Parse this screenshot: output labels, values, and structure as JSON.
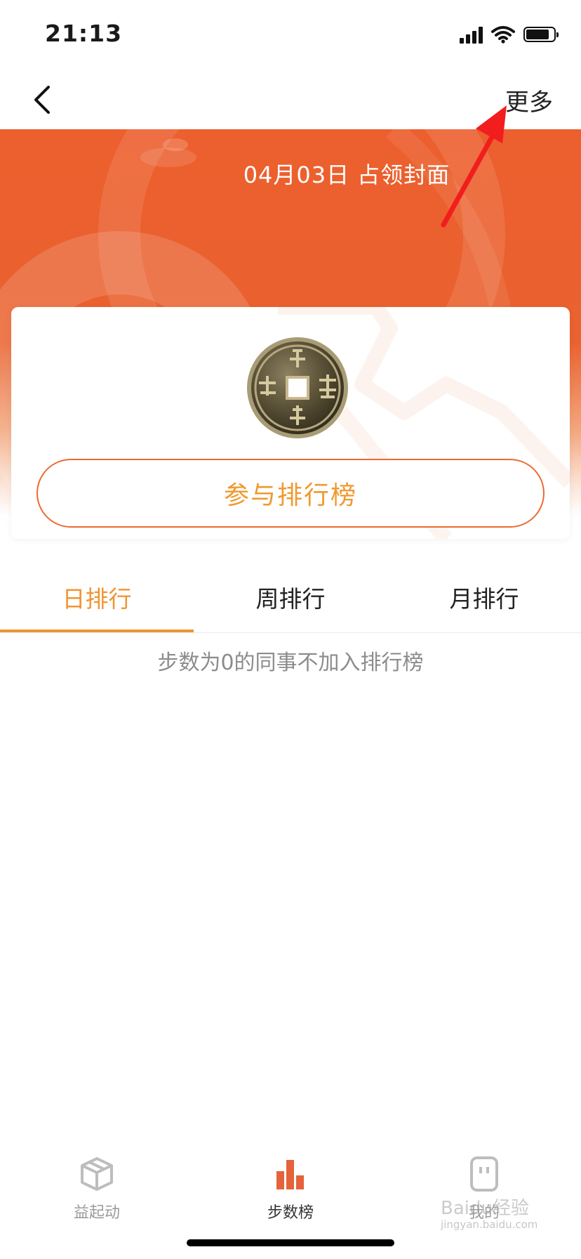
{
  "status_bar": {
    "time": "21:13"
  },
  "nav": {
    "more_label": "更多"
  },
  "hero": {
    "title": "04月03日 占领封面"
  },
  "card": {
    "join_label": "参与排行榜"
  },
  "tabs": [
    {
      "label": "日排行",
      "active": true
    },
    {
      "label": "周排行",
      "active": false
    },
    {
      "label": "月排行",
      "active": false
    }
  ],
  "empty_hint": "步数为0的同事不加入排行榜",
  "tab_bar": [
    {
      "label": "益起动",
      "icon": "box-icon",
      "active": false
    },
    {
      "label": "步数榜",
      "icon": "bar-chart-icon",
      "active": true
    },
    {
      "label": "我的",
      "icon": "profile-icon",
      "active": false
    }
  ],
  "watermark": {
    "brand": "Baidu经验",
    "url": "jingyan.baidu.com"
  },
  "colors": {
    "hero_orange": "#ec5f2e",
    "accent": "#f19433",
    "button_border": "#ee6a30",
    "annotation_red": "#f21d1d"
  }
}
